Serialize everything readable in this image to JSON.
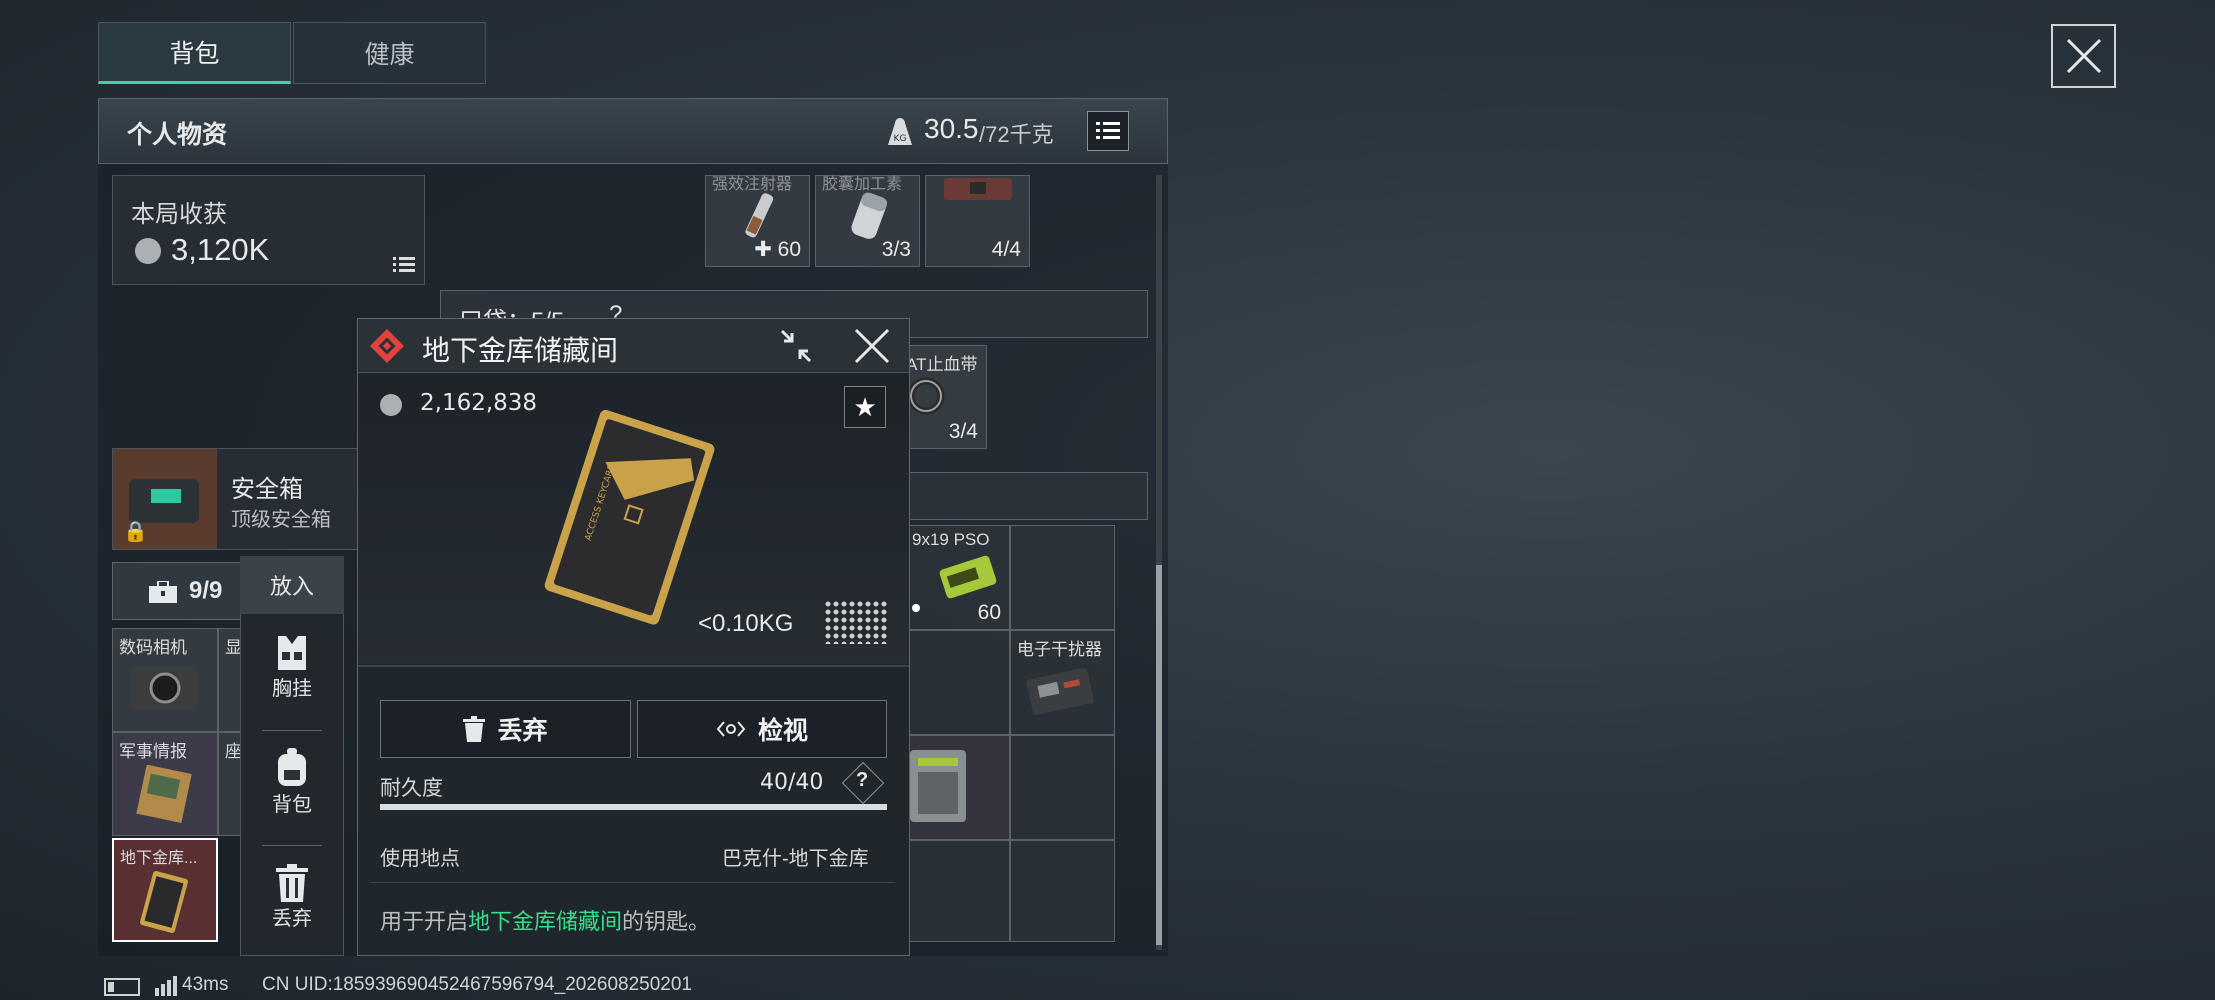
{
  "tabs": [
    {
      "label": "背包"
    },
    {
      "label": "健康"
    }
  ],
  "header": {
    "title": "个人物资",
    "weight_current": "30.5",
    "weight_max": "/72千克",
    "weight_icon_text": "KG"
  },
  "earnings": {
    "label": "本局收获",
    "value": "3,120K"
  },
  "top_slots": [
    {
      "name": "强效注射器",
      "count": "60"
    },
    {
      "name": "胶囊加工素",
      "count": "3/3"
    },
    {
      "name": "",
      "count": "4/4"
    }
  ],
  "pocket": {
    "label": "口袋：5/5",
    "help": "?"
  },
  "bandage": {
    "name": "AT止血带",
    "count": "3/4"
  },
  "safebox": {
    "title": "安全箱",
    "subtitle": "顶级安全箱"
  },
  "case": {
    "count": "9/9"
  },
  "left_items": [
    {
      "name": "数码相机"
    },
    {
      "name": "显"
    },
    {
      "name": "军事情报"
    },
    {
      "name": "座"
    },
    {
      "name": "地下金库..."
    }
  ],
  "context_menu": {
    "header": "放入",
    "items": [
      {
        "label": "胸挂"
      },
      {
        "label": "背包"
      },
      {
        "label": "丢弃"
      }
    ]
  },
  "ammo": {
    "name": "9x19 PSO",
    "count": "60"
  },
  "jammer": {
    "name": "电子干扰器"
  },
  "popup": {
    "title": "地下金库储藏间",
    "price": "2,162,838",
    "weight": "<0.10KG",
    "discard_label": "丢弃",
    "inspect_label": "检视",
    "durability_label": "耐久度",
    "durability_value": "40/40",
    "durability_fraction": 1.0,
    "help": "?",
    "location_label": "使用地点",
    "location_value": "巴克什-地下金库",
    "desc_prefix": "用于开启",
    "desc_highlight": "地下金库储藏间",
    "desc_suffix": "的钥匙。",
    "card_text": "ACCESS KEYCARD"
  },
  "status_bar": {
    "ping": "43ms",
    "uid": "CN UID:18593969045246759679​4_202608250201"
  },
  "colors": {
    "accent": "#3fd1a7",
    "highlight": "#36e08a",
    "danger": "#e0433d",
    "gold": "#c9a24a"
  }
}
